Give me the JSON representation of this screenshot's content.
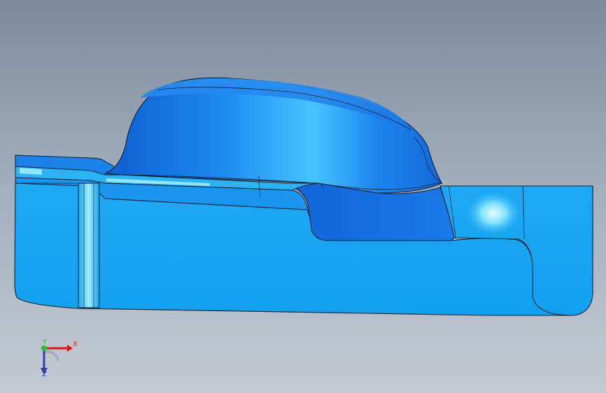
{
  "viewport": {
    "background_top": "#7e8a9a",
    "background_bottom": "#c3cad3"
  },
  "model": {
    "face_color": "#18a4f2",
    "dome_color": "#1776e4",
    "highlight_color": "#56d9ff",
    "edge_color": "#0b2133"
  },
  "triad": {
    "x_label": "X",
    "y_label": "Y",
    "z_label": "Z",
    "x_color": "#d8191d",
    "y_color": "#2fbf3a",
    "z_color": "#2e3fa8"
  }
}
